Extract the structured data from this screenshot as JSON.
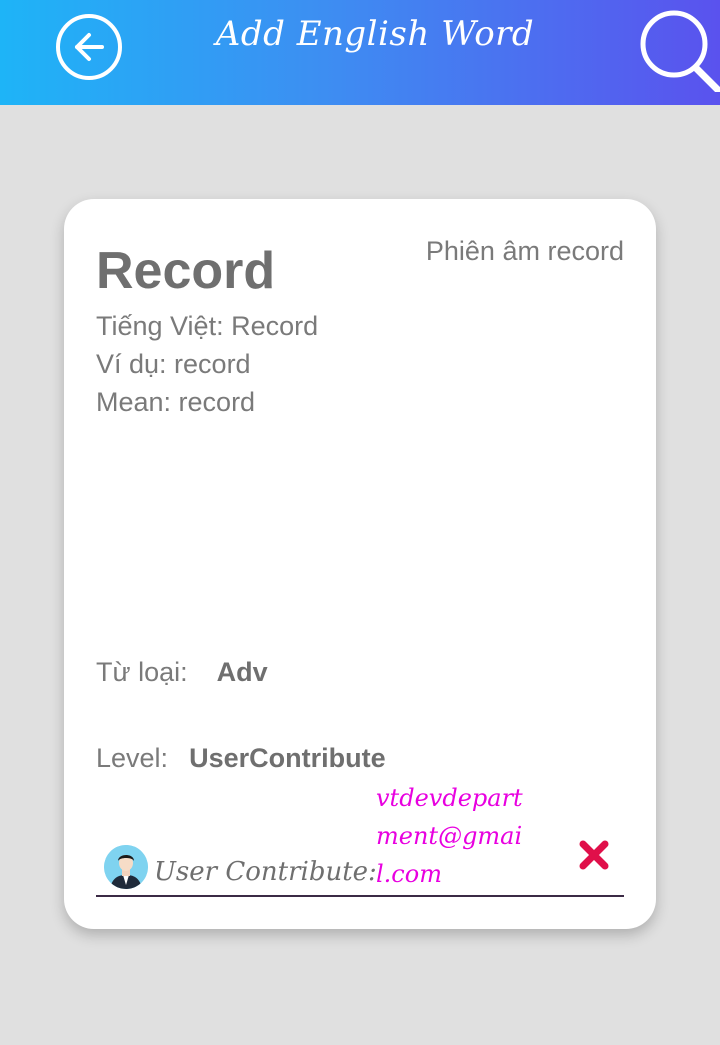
{
  "header": {
    "title": "Add English Word",
    "back_icon": "arrow-left-circle-icon",
    "search_icon": "search-icon",
    "gradient_start": "#1eb4f7",
    "gradient_end": "#5a52ee"
  },
  "card": {
    "word": "Record",
    "phonetic": "Phiên âm record",
    "vietnamese": "Tiếng Việt: Record",
    "example": "Ví dụ: record",
    "mean": "Mean: record",
    "word_type_label": "Từ loại:",
    "word_type_value": "Adv",
    "level_label": "Level:",
    "level_value": "UserContribute",
    "contributor_label": "User Contribute:",
    "contributor_email": "vtdevdepartment@gmail.com",
    "delete_icon": "close-x-icon",
    "email_color": "#e800e0",
    "delete_color": "#e0104a"
  }
}
